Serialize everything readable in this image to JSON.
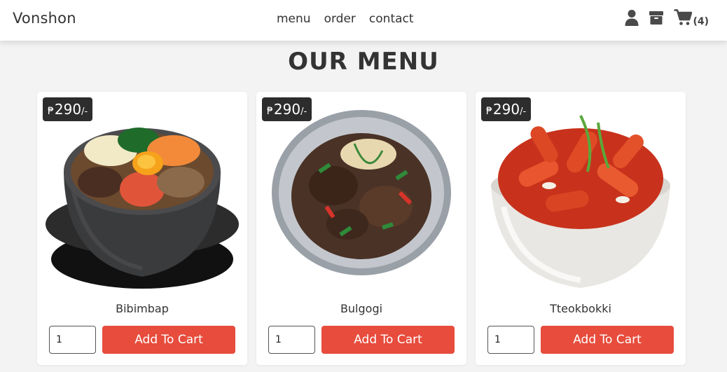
{
  "header": {
    "logo": "Vonshon",
    "nav": [
      {
        "label": "menu"
      },
      {
        "label": "order"
      },
      {
        "label": "contact"
      }
    ],
    "icons": [
      "user-icon",
      "box-icon",
      "cart-icon"
    ],
    "cart_count": "(4)"
  },
  "page_title": "OUR MENU",
  "colors": {
    "accent": "#e74c3c",
    "price_tag_bg": "#2d2d2d",
    "page_bg": "#f3f3f3"
  },
  "items": [
    {
      "name": "Bibimbap",
      "currency": "₱",
      "price": "290",
      "price_suffix": "/-",
      "quantity": "1",
      "button_label": "Add To Cart"
    },
    {
      "name": "Bulgogi",
      "currency": "₱",
      "price": "290",
      "price_suffix": "/-",
      "quantity": "1",
      "button_label": "Add To Cart"
    },
    {
      "name": "Tteokbokki",
      "currency": "₱",
      "price": "290",
      "price_suffix": "/-",
      "quantity": "1",
      "button_label": "Add To Cart"
    }
  ]
}
